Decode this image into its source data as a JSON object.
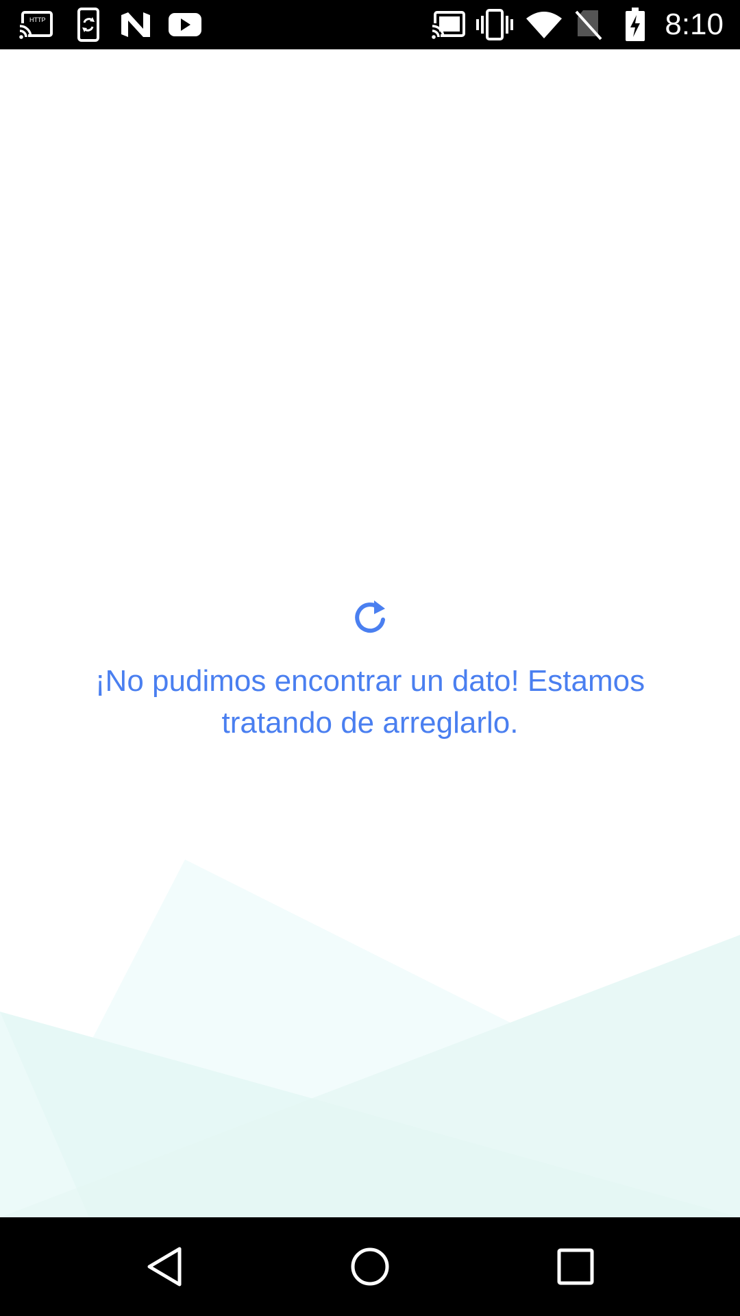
{
  "status_bar": {
    "time": "8:10",
    "left_icons": [
      "cast-http-icon",
      "phone-sync-icon",
      "n-logo-icon",
      "youtube-icon"
    ],
    "right_icons": [
      "cast-icon",
      "vibrate-icon",
      "wifi-icon",
      "no-sim-icon",
      "battery-charging-icon"
    ]
  },
  "main": {
    "refresh_icon": "refresh-icon",
    "error_message": "¡No pudimos encontrar un dato! Estamos tratando de arreglarlo.",
    "accent_color": "#4a7ff0"
  },
  "nav_bar": {
    "buttons": [
      "back-icon",
      "home-icon",
      "recents-icon"
    ]
  }
}
